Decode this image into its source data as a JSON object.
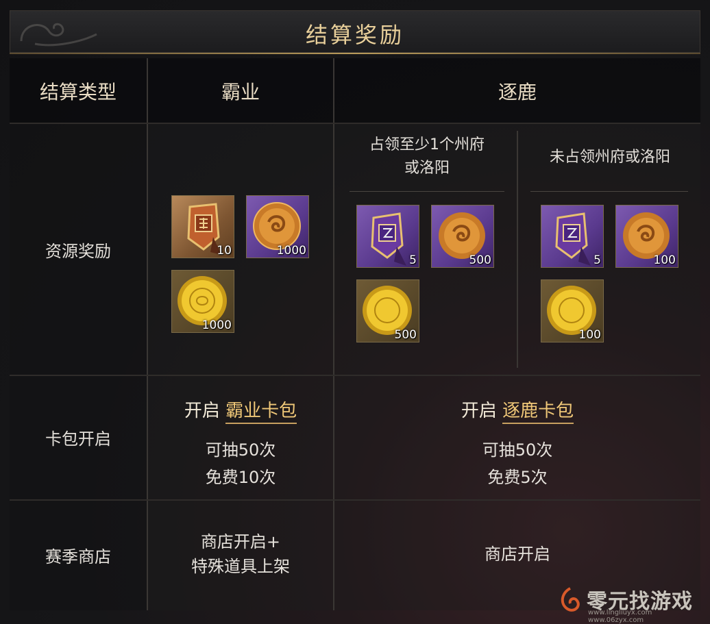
{
  "title": "结算奖励",
  "headers": {
    "type_label": "结算类型",
    "col1": "霸业",
    "col2": "逐鹿"
  },
  "rows": {
    "resource": "资源奖励",
    "card_pack": "卡包开启",
    "shop": "赛季商店"
  },
  "zhulu_sub": {
    "occupy": "占领至少1个州府或洛阳",
    "occupy_line1": "占领至少1个州府",
    "occupy_line2": "或洛阳",
    "not_occupy": "未占领州府或洛阳"
  },
  "baye_items": [
    {
      "icon": "ba-banner-icon",
      "qty": "10"
    },
    {
      "icon": "jade-coin-icon",
      "qty": "1000"
    },
    {
      "icon": "gold-coin-icon",
      "qty": "1000"
    }
  ],
  "zhulu_occupy_items": [
    {
      "icon": "zhu-banner-icon",
      "qty": "5"
    },
    {
      "icon": "jade-coin-icon",
      "qty": "500"
    },
    {
      "icon": "gold-coin-icon",
      "qty": "500"
    }
  ],
  "zhulu_not_items": [
    {
      "icon": "zhu-banner-icon",
      "qty": "5"
    },
    {
      "icon": "jade-coin-icon",
      "qty": "100"
    },
    {
      "icon": "gold-coin-icon",
      "qty": "100"
    }
  ],
  "baye_pack": {
    "prefix": "开启",
    "name": "霸业卡包",
    "draws": "可抽50次",
    "free": "免费10次"
  },
  "zhulu_pack": {
    "prefix": "开启",
    "name": "逐鹿卡包",
    "draws": "可抽50次",
    "free": "免费5次"
  },
  "shop": {
    "baye_line1": "商店开启+",
    "baye_line2": "特殊道具上架",
    "zhulu": "商店开启"
  },
  "watermark": {
    "name": "零元找游戏",
    "url": "www.lingliuyx.com  www.06zyx.com"
  },
  "colors": {
    "title_gold": "#e8cf9a",
    "pack_name_gold": "#f0c878",
    "item_orange": "#b8895a",
    "item_purple": "#7d5ab0"
  }
}
